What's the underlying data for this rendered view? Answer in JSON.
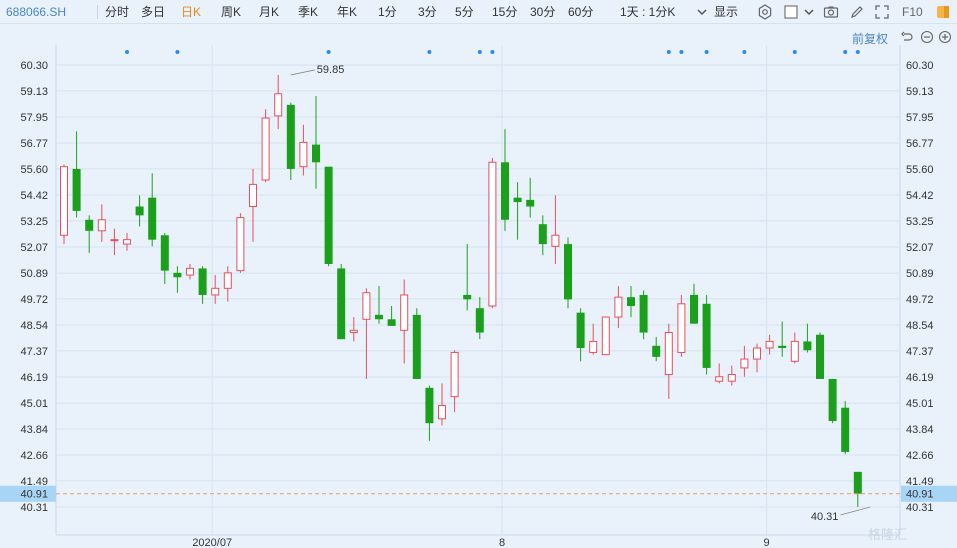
{
  "toolbar": {
    "symbol": "688066.SH",
    "periods": [
      "分时",
      "多日",
      "日K",
      "周K",
      "月K",
      "季K",
      "年K",
      "1分",
      "3分",
      "5分",
      "15分",
      "30分",
      "60分"
    ],
    "active_period": "日K",
    "interval_select": "1天 : 1分K",
    "display_label": "显示",
    "f10_label": "F10"
  },
  "chart_controls": {
    "adjust_label": "前复权"
  },
  "watermark": "格隆汇",
  "colors": {
    "up": "#e8505b",
    "down": "#1ba01b",
    "dot": "#2a8cf0",
    "price_tag_bg": "#a8d4f5",
    "current_line": "#e8a05a"
  },
  "chart_data": {
    "type": "candlestick",
    "price_axis_ticks": [
      "60.30",
      "59.13",
      "57.95",
      "56.77",
      "55.60",
      "54.42",
      "53.25",
      "52.07",
      "50.89",
      "49.72",
      "48.54",
      "47.37",
      "46.19",
      "45.01",
      "43.84",
      "42.66",
      "41.49",
      "40.31"
    ],
    "ylim": [
      40.31,
      60.3
    ],
    "x_tick_labels": [
      {
        "label": "2020/07",
        "index": 12
      },
      {
        "label": "8",
        "index": 35
      },
      {
        "label": "9",
        "index": 56
      }
    ],
    "high_annotation": {
      "label": "59.85",
      "value": 59.85,
      "index": 18
    },
    "low_annotation": {
      "label": "40.31",
      "value": 40.31,
      "index": 64
    },
    "current_price": {
      "label": "40.91",
      "value": 40.91
    },
    "event_markers": [
      5,
      9,
      21,
      29,
      33,
      34,
      48,
      49,
      51,
      54,
      58,
      62,
      63
    ],
    "candles": [
      {
        "o": 52.6,
        "h": 55.8,
        "l": 52.2,
        "c": 55.7
      },
      {
        "o": 55.6,
        "h": 57.3,
        "l": 53.4,
        "c": 53.7
      },
      {
        "o": 53.3,
        "h": 53.5,
        "l": 51.8,
        "c": 52.8
      },
      {
        "o": 52.8,
        "h": 54.0,
        "l": 52.3,
        "c": 53.3
      },
      {
        "o": 52.4,
        "h": 52.9,
        "l": 51.7,
        "c": 52.4
      },
      {
        "o": 52.2,
        "h": 52.7,
        "l": 51.9,
        "c": 52.4
      },
      {
        "o": 53.9,
        "h": 54.4,
        "l": 53.0,
        "c": 53.5
      },
      {
        "o": 54.3,
        "h": 55.4,
        "l": 52.1,
        "c": 52.4
      },
      {
        "o": 52.6,
        "h": 52.7,
        "l": 50.4,
        "c": 51.0
      },
      {
        "o": 50.9,
        "h": 51.2,
        "l": 50.0,
        "c": 50.7
      },
      {
        "o": 50.8,
        "h": 51.3,
        "l": 50.6,
        "c": 51.1
      },
      {
        "o": 51.1,
        "h": 51.2,
        "l": 49.5,
        "c": 49.9
      },
      {
        "o": 49.9,
        "h": 50.8,
        "l": 49.5,
        "c": 50.2
      },
      {
        "o": 50.2,
        "h": 51.2,
        "l": 49.6,
        "c": 50.9
      },
      {
        "o": 51.0,
        "h": 53.6,
        "l": 50.9,
        "c": 53.4
      },
      {
        "o": 53.9,
        "h": 55.6,
        "l": 52.3,
        "c": 54.9
      },
      {
        "o": 55.1,
        "h": 58.3,
        "l": 55.0,
        "c": 57.9
      },
      {
        "o": 58.0,
        "h": 59.85,
        "l": 57.4,
        "c": 59.0
      },
      {
        "o": 58.5,
        "h": 58.6,
        "l": 55.1,
        "c": 55.6
      },
      {
        "o": 55.7,
        "h": 57.6,
        "l": 55.3,
        "c": 56.8
      },
      {
        "o": 56.7,
        "h": 58.9,
        "l": 54.7,
        "c": 55.9
      },
      {
        "o": 55.7,
        "h": 55.7,
        "l": 51.2,
        "c": 51.3
      },
      {
        "o": 51.1,
        "h": 51.3,
        "l": 47.9,
        "c": 47.9
      },
      {
        "o": 48.2,
        "h": 48.9,
        "l": 47.8,
        "c": 48.3
      },
      {
        "o": 48.8,
        "h": 50.2,
        "l": 46.1,
        "c": 50.0
      },
      {
        "o": 49.0,
        "h": 50.3,
        "l": 48.6,
        "c": 48.8
      },
      {
        "o": 48.8,
        "h": 49.4,
        "l": 48.5,
        "c": 48.5
      },
      {
        "o": 48.3,
        "h": 50.6,
        "l": 46.8,
        "c": 49.9
      },
      {
        "o": 49.0,
        "h": 49.3,
        "l": 46.1,
        "c": 46.1
      },
      {
        "o": 45.7,
        "h": 45.8,
        "l": 43.3,
        "c": 44.1
      },
      {
        "o": 44.3,
        "h": 45.9,
        "l": 44.0,
        "c": 44.9
      },
      {
        "o": 45.3,
        "h": 47.4,
        "l": 44.6,
        "c": 47.3
      },
      {
        "o": 49.9,
        "h": 52.2,
        "l": 49.2,
        "c": 49.7
      },
      {
        "o": 49.3,
        "h": 49.8,
        "l": 47.9,
        "c": 48.2
      },
      {
        "o": 49.4,
        "h": 56.1,
        "l": 49.3,
        "c": 55.9
      },
      {
        "o": 55.9,
        "h": 57.4,
        "l": 52.8,
        "c": 53.3
      },
      {
        "o": 54.3,
        "h": 55.0,
        "l": 52.4,
        "c": 54.1
      },
      {
        "o": 54.2,
        "h": 55.2,
        "l": 53.4,
        "c": 53.9
      },
      {
        "o": 53.1,
        "h": 53.5,
        "l": 51.7,
        "c": 52.2
      },
      {
        "o": 52.1,
        "h": 54.4,
        "l": 51.3,
        "c": 52.6
      },
      {
        "o": 52.2,
        "h": 52.5,
        "l": 49.3,
        "c": 49.7
      },
      {
        "o": 49.1,
        "h": 49.3,
        "l": 46.9,
        "c": 47.5
      },
      {
        "o": 47.3,
        "h": 48.6,
        "l": 47.2,
        "c": 47.8
      },
      {
        "o": 47.2,
        "h": 48.9,
        "l": 47.2,
        "c": 48.9
      },
      {
        "o": 48.9,
        "h": 50.3,
        "l": 48.4,
        "c": 49.8
      },
      {
        "o": 49.8,
        "h": 50.3,
        "l": 48.9,
        "c": 49.4
      },
      {
        "o": 49.9,
        "h": 50.1,
        "l": 47.9,
        "c": 48.2
      },
      {
        "o": 47.6,
        "h": 48.0,
        "l": 46.9,
        "c": 47.1
      },
      {
        "o": 46.3,
        "h": 48.6,
        "l": 45.2,
        "c": 48.2
      },
      {
        "o": 47.3,
        "h": 49.9,
        "l": 47.1,
        "c": 49.5
      },
      {
        "o": 49.9,
        "h": 50.4,
        "l": 48.6,
        "c": 48.6
      },
      {
        "o": 49.5,
        "h": 49.9,
        "l": 46.3,
        "c": 46.6
      },
      {
        "o": 46.0,
        "h": 46.8,
        "l": 45.9,
        "c": 46.2
      },
      {
        "o": 46.0,
        "h": 46.7,
        "l": 45.8,
        "c": 46.3
      },
      {
        "o": 46.6,
        "h": 47.6,
        "l": 46.2,
        "c": 47.0
      },
      {
        "o": 47.0,
        "h": 47.7,
        "l": 46.4,
        "c": 47.5
      },
      {
        "o": 47.5,
        "h": 48.1,
        "l": 47.2,
        "c": 47.8
      },
      {
        "o": 47.6,
        "h": 48.7,
        "l": 47.1,
        "c": 47.5
      },
      {
        "o": 46.9,
        "h": 48.2,
        "l": 46.8,
        "c": 47.8
      },
      {
        "o": 47.8,
        "h": 48.6,
        "l": 47.3,
        "c": 47.4
      },
      {
        "o": 48.1,
        "h": 48.2,
        "l": 46.1,
        "c": 46.1
      },
      {
        "o": 46.1,
        "h": 46.1,
        "l": 44.1,
        "c": 44.2
      },
      {
        "o": 44.8,
        "h": 45.1,
        "l": 42.7,
        "c": 42.8
      },
      {
        "o": 41.9,
        "h": 41.9,
        "l": 40.31,
        "c": 40.91
      }
    ]
  }
}
